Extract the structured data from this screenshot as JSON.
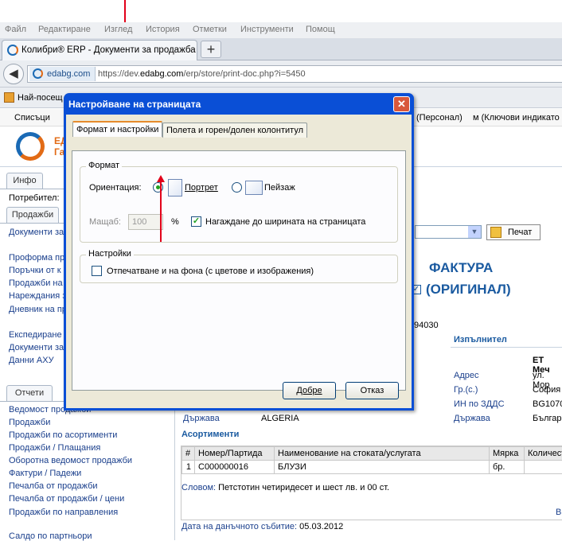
{
  "browser": {
    "menu": [
      "Файл",
      "Редактиране",
      "Изглед",
      "История",
      "Отметки",
      "Инструменти",
      "Помощ"
    ],
    "tab_title": "Колибри® ERP - Документи за продажба",
    "new_tab": "+",
    "url_host": "edabg.com",
    "url_prefix": "https://dev.",
    "url_host_part": "edabg.com",
    "url_path": "/erp/store/print-doc.php?i=5450",
    "bookmark": "Най-посещ"
  },
  "app": {
    "menu": [
      "Списъци",
      "(Персонал)",
      "м (Ключови индикато"
    ],
    "logo_text": [
      "ЕД",
      "Га"
    ],
    "sidebar": {
      "tab_info": "Инфо",
      "user_label": "Потребител:",
      "tab_sales": "Продажби",
      "links1": [
        "Документи за"
      ],
      "links2": [
        "Проформа про",
        "Поръчки от к",
        "Продажби на",
        "Нареждания з",
        "Дневник на пр"
      ],
      "links3": [
        "Експедиране",
        "Документи за",
        "Данни АХУ"
      ],
      "tab_reports": "Отчети",
      "links4": [
        "Ведомост продажби",
        "Продажби",
        "Продажби по асортименти",
        "Продажби / Плащания",
        "Оборотна ведомост продажби",
        "Фактури / Падежи",
        "Печалба от продажби",
        "Печалба от продажби / цени",
        "Продажби по направления",
        "Салдо по партньори"
      ]
    },
    "main": {
      "print_button": "Печат",
      "invoice_title": "ФАКТУРА",
      "invoice_sub": "(ОРИГИНАЛ)",
      "number_tail": "94030",
      "performer": "Изпълнител",
      "right_labels": [
        "Адрес",
        "Гр.(с.)",
        "ИН по ЗДДС",
        "Държава"
      ],
      "right_values": [
        "ЕТ Мeч",
        "ул. Мор",
        "София",
        "BG1070",
        "Българ"
      ],
      "left_country_label": "Държава",
      "left_country_value": "ALGERIA",
      "assort_title": "Асортименти",
      "table_headers": [
        "#",
        "Номер/Партида",
        "Наименование на стоката/услугата",
        "Мярка",
        "Количест"
      ],
      "table_row": [
        "1",
        "C000000016",
        "БЛУЗИ",
        "бр.",
        ""
      ],
      "words_label": "Словом:",
      "words_value": "Петстотин четиридесет и шест лв. и 00 ст.",
      "tax_date_label": "Дата на данъчното събитие:",
      "tax_date_value": "05.03.2012",
      "side_letter": "В"
    }
  },
  "dialog": {
    "title": "Настройване на страницата",
    "close": "✕",
    "tab1": "Формат и настройки",
    "tab2": "Полета и горен/долен колонтитул",
    "format_group": "Формат",
    "orientation_label": "Ориентация:",
    "portrait": "Портрет",
    "landscape": "Пейзаж",
    "scale_label": "Мащаб:",
    "scale_value": "100",
    "percent": "%",
    "shrink_label": "Нагаждане до ширината на страницата",
    "settings_group": "Настройки",
    "print_bg_label": "Отпечатване и на фона (с цветове и изображения)",
    "ok": "Добре",
    "cancel": "Отказ"
  }
}
